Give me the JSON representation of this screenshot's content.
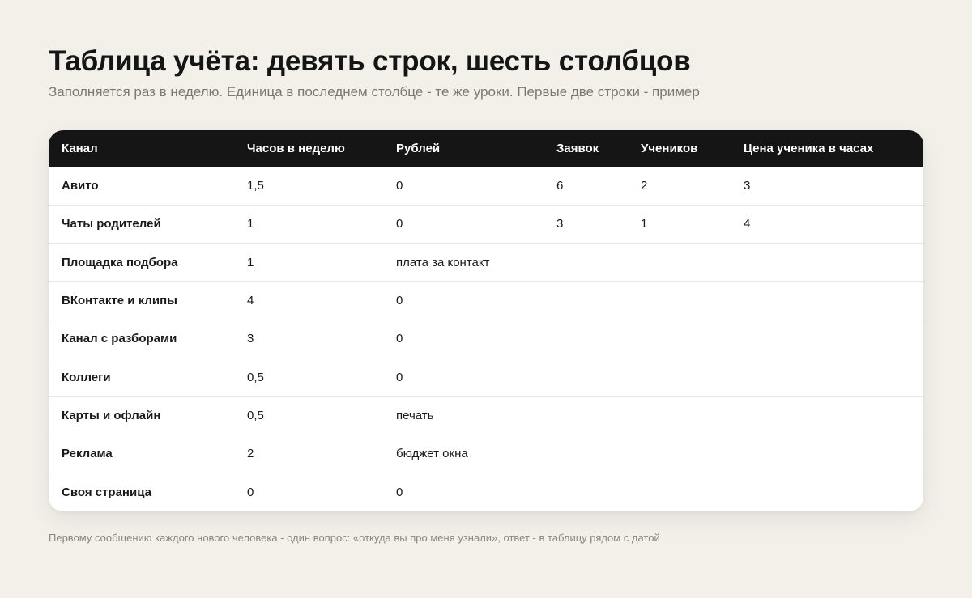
{
  "title": "Таблица учёта: девять строк, шесть столбцов",
  "subtitle": "Заполняется раз в неделю. Единица в последнем столбце - те же уроки. Первые две строки - пример",
  "table": {
    "headers": [
      "Канал",
      "Часов в неделю",
      "Рублей",
      "Заявок",
      "Учеников",
      "Цена ученика в часах"
    ],
    "rows": [
      [
        "Авито",
        "1,5",
        "0",
        "6",
        "2",
        "3"
      ],
      [
        "Чаты родителей",
        "1",
        "0",
        "3",
        "1",
        "4"
      ],
      [
        "Площадка подбора",
        "1",
        "плата за контакт",
        "",
        "",
        ""
      ],
      [
        "ВКонтакте и клипы",
        "4",
        "0",
        "",
        "",
        ""
      ],
      [
        "Канал с разборами",
        "3",
        "0",
        "",
        "",
        ""
      ],
      [
        "Коллеги",
        "0,5",
        "0",
        "",
        "",
        ""
      ],
      [
        "Карты и офлайн",
        "0,5",
        "печать",
        "",
        "",
        ""
      ],
      [
        "Реклама",
        "2",
        "бюджет окна",
        "",
        "",
        ""
      ],
      [
        "Своя страница",
        "0",
        "0",
        "",
        "",
        ""
      ]
    ]
  },
  "footnote": "Первому сообщению каждого нового человека - один вопрос: «откуда вы про меня узнали», ответ - в таблицу рядом с датой",
  "colors": {
    "background": "#f3f0ea",
    "header_bg": "#151515",
    "header_text": "#ffffff",
    "subtitle": "#7b7873"
  }
}
